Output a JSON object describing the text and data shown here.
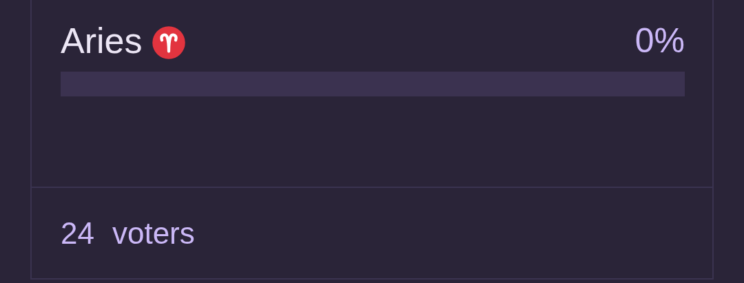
{
  "option": {
    "label": "Aries",
    "percent": "0%",
    "level": 0
  },
  "footer": {
    "count": "24",
    "label": "voters"
  }
}
